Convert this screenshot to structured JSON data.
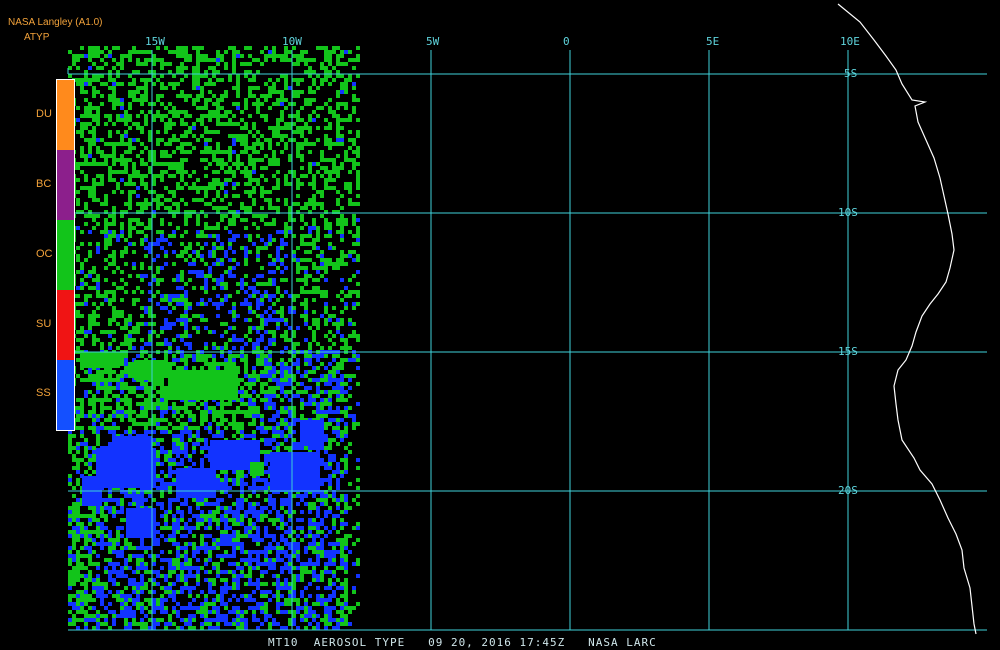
{
  "header": {
    "source": "NASA Langley (A1.0)",
    "product": "ATYP"
  },
  "legend": {
    "categories": [
      {
        "label": "DU",
        "color": "#ff8a1c"
      },
      {
        "label": "BC",
        "color": "#8c1f8c"
      },
      {
        "label": "OC",
        "color": "#12c41a"
      },
      {
        "label": "SU",
        "color": "#f01414"
      },
      {
        "label": "SS",
        "color": "#1450ff"
      }
    ]
  },
  "map": {
    "lon_labels": [
      "15W",
      "10W",
      "5W",
      "0",
      "5E",
      "10E"
    ],
    "lat_labels": [
      "5S",
      "10S",
      "15S",
      "20S"
    ],
    "grid_color": "#3fd2da",
    "coast_color": "#ffffff",
    "oc_color": "#12c41a",
    "ss_color": "#1233ff"
  },
  "footer": {
    "caption": "MT10  AEROSOL TYPE   09 20, 2016 17:45Z   NASA LARC"
  }
}
